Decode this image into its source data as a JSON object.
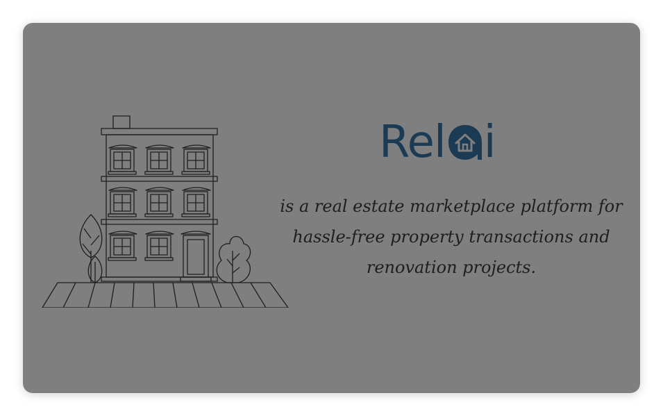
{
  "card": {
    "background": "#7f7f7f"
  },
  "illustration": {
    "icon": "apartment-building-illustration"
  },
  "logo": {
    "prefix": "Rel",
    "suffix": "i",
    "mark": "house-in-circle-icon",
    "color": "#1b3b55"
  },
  "tagline": {
    "text": "is a real estate marketplace platform for hassle-free property transactions and renovation projects."
  }
}
